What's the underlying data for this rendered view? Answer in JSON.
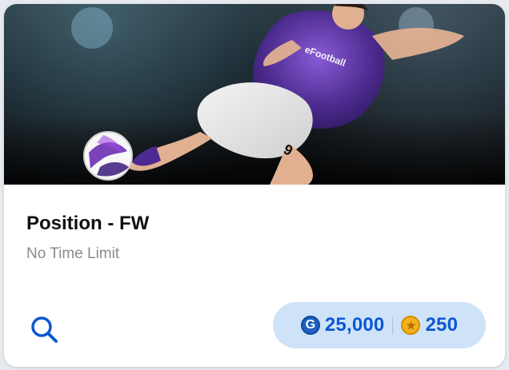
{
  "card": {
    "title": "Position - FW",
    "subtitle": "No Time Limit",
    "hero": {
      "image_alt": "eFootball player kicking ball",
      "jersey_text": "eFootball",
      "jersey_number": "9"
    },
    "search": {
      "icon": "search-icon"
    },
    "price": {
      "gp": {
        "icon": "gp-coin-icon",
        "glyph": "G",
        "value": "25,000"
      },
      "coins": {
        "icon": "star-coin-icon",
        "glyph": "★",
        "value": "250"
      }
    }
  },
  "colors": {
    "accent_blue": "#0b58d2",
    "pill_bg": "#cfe3f8",
    "title": "#111111",
    "subtitle": "#8b8b8b"
  }
}
